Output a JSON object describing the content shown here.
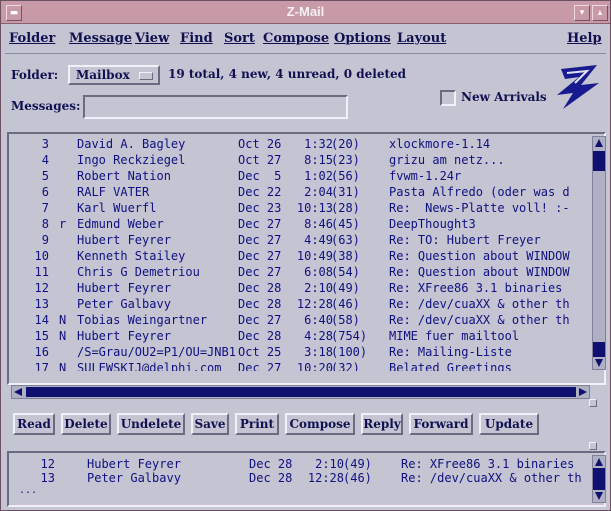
{
  "window": {
    "title": "Z-Mail"
  },
  "menubar": {
    "items": [
      "Folder",
      "Message",
      "View",
      "Find",
      "Sort",
      "Compose",
      "Options",
      "Layout"
    ],
    "help": "Help"
  },
  "folder": {
    "label": "Folder:",
    "value": "Mailbox",
    "status": "19 total, 4 new, 4 unread, 0 deleted"
  },
  "messages_field": {
    "label": "Messages:",
    "value": ""
  },
  "new_arrivals": {
    "label": "New Arrivals",
    "checked": false
  },
  "message_list": {
    "rows": [
      {
        "num": "3",
        "flag": "",
        "from": "David A. Bagley",
        "date": "Oct 26",
        "time": "1:32",
        "size": "(20)",
        "subject": "xlockmore-1.14"
      },
      {
        "num": "4",
        "flag": "",
        "from": "Ingo Reckziegel",
        "date": "Oct 27",
        "time": "8:15",
        "size": "(23)",
        "subject": "grizu am netz..."
      },
      {
        "num": "5",
        "flag": "",
        "from": "Robert Nation",
        "date": "Dec  5",
        "time": "1:02",
        "size": "(56)",
        "subject": "fvwm-1.24r"
      },
      {
        "num": "6",
        "flag": "",
        "from": "RALF VATER",
        "date": "Dec 22",
        "time": "2:04",
        "size": "(31)",
        "subject": "Pasta Alfredo (oder was d"
      },
      {
        "num": "7",
        "flag": "",
        "from": "Karl Wuerfl",
        "date": "Dec 23",
        "time": "10:13",
        "size": "(28)",
        "subject": "Re:  News-Platte voll! :-"
      },
      {
        "num": "8",
        "flag": "r",
        "from": "Edmund Weber",
        "date": "Dec 27",
        "time": "8:46",
        "size": "(45)",
        "subject": "DeepThought3"
      },
      {
        "num": "9",
        "flag": "",
        "from": "Hubert Feyrer",
        "date": "Dec 27",
        "time": "4:49",
        "size": "(63)",
        "subject": "Re: TO: Hubert Freyer"
      },
      {
        "num": "10",
        "flag": "",
        "from": "Kenneth Stailey",
        "date": "Dec 27",
        "time": "10:49",
        "size": "(38)",
        "subject": "Re: Question about WINDOW"
      },
      {
        "num": "11",
        "flag": "",
        "from": "Chris G Demetriou",
        "date": "Dec 27",
        "time": "6:08",
        "size": "(54)",
        "subject": "Re: Question about WINDOW"
      },
      {
        "num": "12",
        "flag": "",
        "from": "Hubert Feyrer",
        "date": "Dec 28",
        "time": "2:10",
        "size": "(49)",
        "subject": "Re: XFree86 3.1 binaries"
      },
      {
        "num": "13",
        "flag": "",
        "from": "Peter Galbavy",
        "date": "Dec 28",
        "time": "12:28",
        "size": "(46)",
        "subject": "Re: /dev/cuaXX & other th"
      },
      {
        "num": "14",
        "flag": "N",
        "from": "Tobias Weingartner",
        "date": "Dec 27",
        "time": "6:40",
        "size": "(58)",
        "subject": "Re: /dev/cuaXX & other th"
      },
      {
        "num": "15",
        "flag": "N",
        "from": "Hubert Feyrer",
        "date": "Dec 28",
        "time": "4:28",
        "size": "(754)",
        "subject": "MIME fuer mailtool"
      },
      {
        "num": "16",
        "flag": "",
        "from": "/S=Grau/OU2=P1/OU=JNB1",
        "date": "Oct 25",
        "time": "3:18",
        "size": "(100)",
        "subject": "Re: Mailing-Liste"
      },
      {
        "num": "17",
        "flag": "N",
        "from": "SULEWSKIJ@delphi.com",
        "date": "Dec 27",
        "time": "10:20",
        "size": "(32)",
        "subject": "Belated Greetings"
      }
    ],
    "scroll_position": 0.62,
    "visible_fraction": 0.79
  },
  "buttons": [
    "Read",
    "Delete",
    "Undelete",
    "Save",
    "Print",
    "Compose",
    "Reply",
    "Forward",
    "Update"
  ],
  "preview": {
    "rows": [
      {
        "num": "12",
        "from": "Hubert Feyrer",
        "date": "Dec 28",
        "time": "2:10",
        "size": "(49)",
        "subject": "Re: XFree86 3.1 binaries"
      },
      {
        "num": "13",
        "from": "Peter Galbavy",
        "date": "Dec 28",
        "time": "12:28",
        "size": "(46)",
        "subject": "Re: /dev/cuaXX & other th"
      }
    ],
    "continuation": "..."
  },
  "icons": {
    "window_menu": "window-menu-icon",
    "minimize": "minimize-icon",
    "maximize": "maximize-icon",
    "logo": "zmail-logo-icon",
    "folder_dropdown": "option-menu-icon"
  },
  "colors": {
    "titlebar": "#c89aa8",
    "background": "#c4c4d2",
    "text": "#101080",
    "scroll_thumb": "#101070"
  }
}
